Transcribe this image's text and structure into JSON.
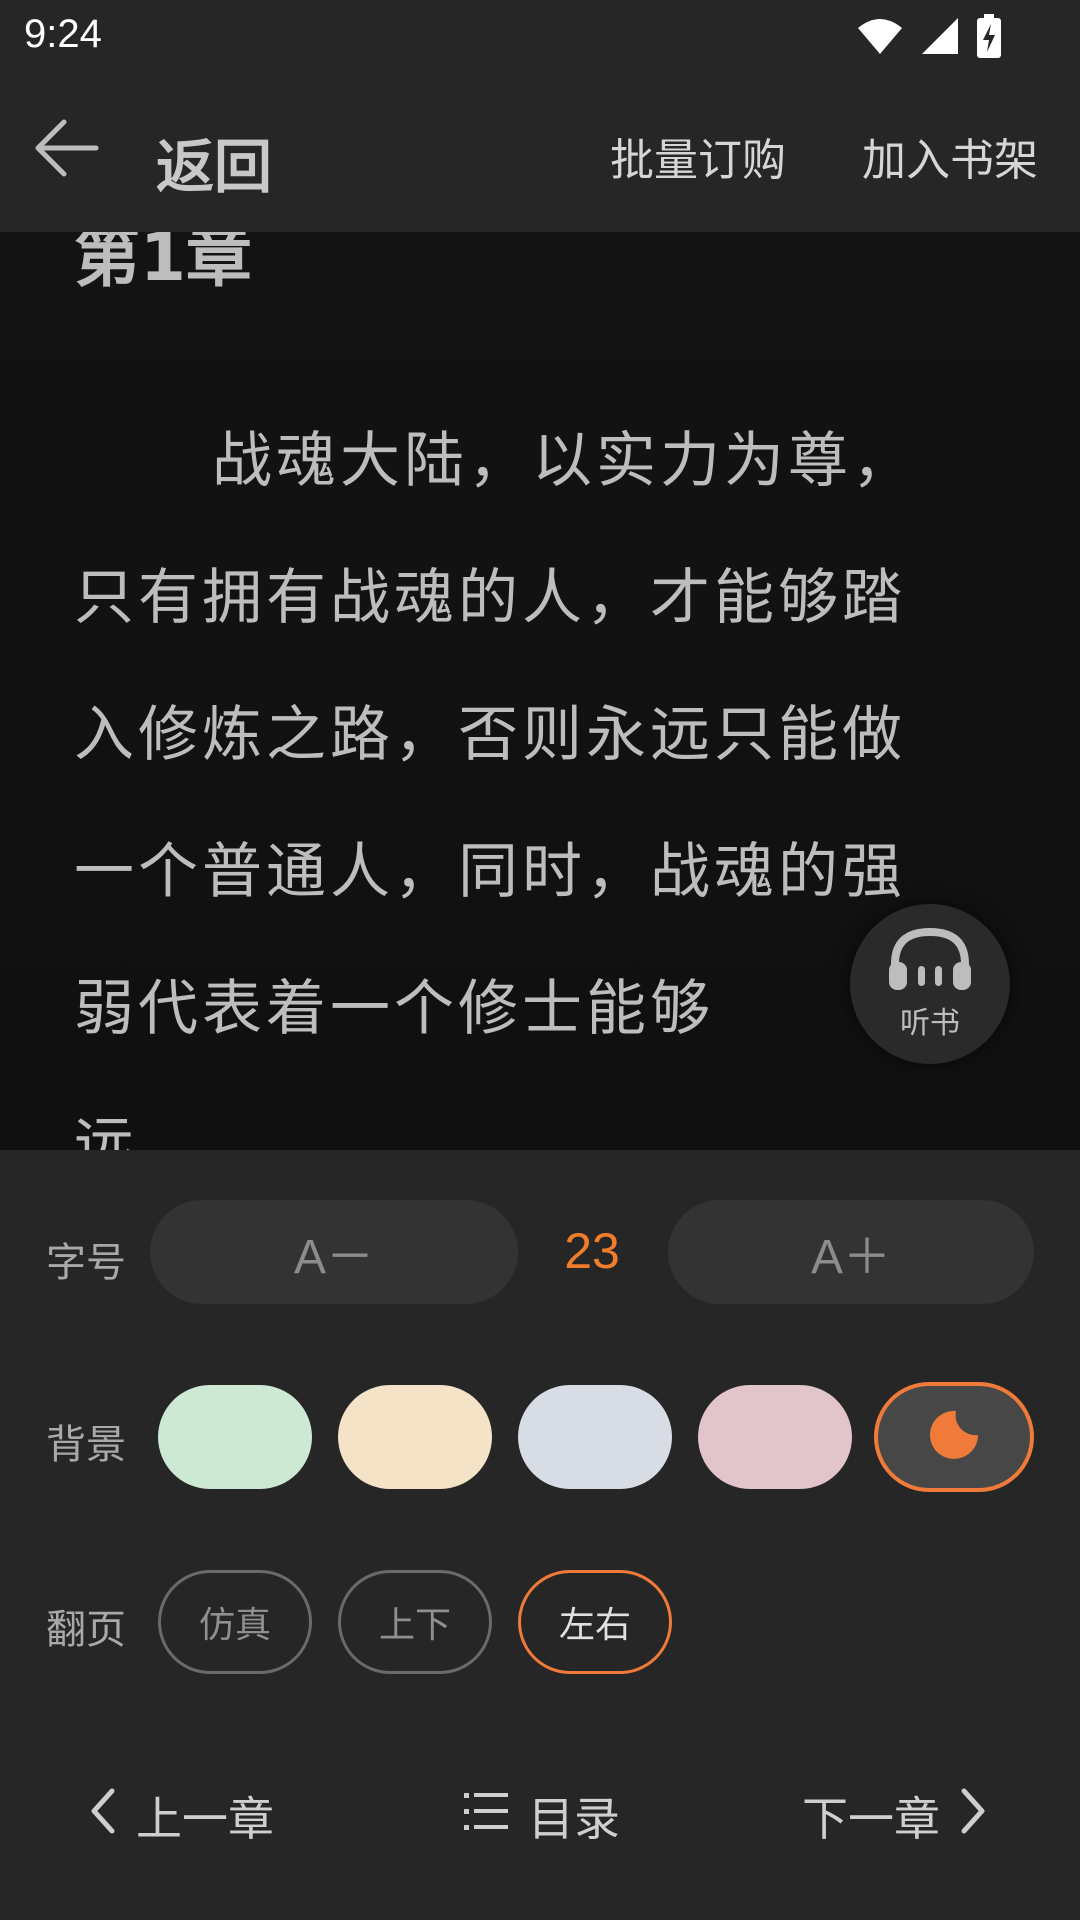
{
  "status_bar": {
    "time": "9:24",
    "icons": [
      "wifi-icon",
      "cellular-signal-icon",
      "battery-charging-icon"
    ]
  },
  "toolbar": {
    "back_label": "返回",
    "batch_buy_label": "批量订购",
    "add_shelf_label": "加入书架"
  },
  "reader": {
    "chapter_title": "第1章",
    "lines": [
      "战魂大陆，以实力为尊，",
      "只有拥有战魂的人，才能够踏",
      "入修炼之路，否则永远只能做",
      "一个普通人，同时，战魂的强",
      "弱代表着一个修士能够",
      "远。"
    ],
    "listen_label": "听书"
  },
  "settings": {
    "font_size_label": "字号",
    "font_decrease_label": "A－",
    "font_size_value": "23",
    "font_increase_label": "A＋",
    "background_label": "背景",
    "backgrounds": [
      {
        "color": "#cde8d3"
      },
      {
        "color": "#f4e3c6"
      },
      {
        "color": "#d8dce4"
      },
      {
        "color": "#e2c5ca"
      },
      {
        "color": "#474747",
        "icon": "moon-icon",
        "selected": true
      }
    ],
    "page_turn_label": "翻页",
    "page_modes": [
      {
        "label": "仿真",
        "selected": false
      },
      {
        "label": "上下",
        "selected": false
      },
      {
        "label": "左右",
        "selected": true
      }
    ]
  },
  "bottom_nav": {
    "prev_label": "上一章",
    "toc_label": "目录",
    "next_label": "下一章"
  },
  "colors": {
    "accent": "#f07a3a",
    "font_value": "#f07d2b"
  }
}
